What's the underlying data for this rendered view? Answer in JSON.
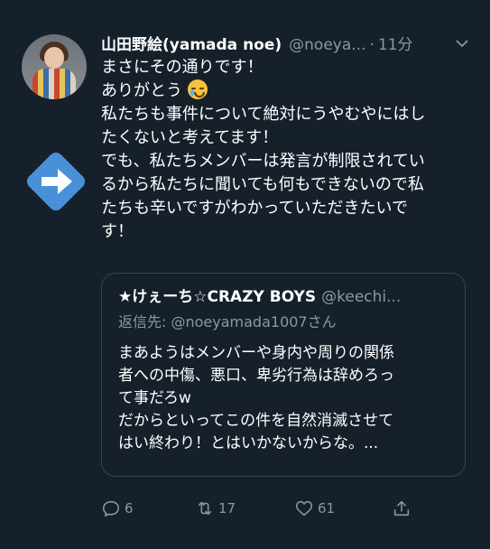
{
  "tweet": {
    "author_name": "山田野絵(yamada noe)",
    "author_handle": "@noeya...",
    "separator": "·",
    "time": "11分",
    "body_lines": [
      "まさにその通りです！",
      "ありがとう",
      "私たちも事件について絶対にうやむやにはし",
      "たくないと考えてます！",
      "でも、私たちメンバーは発言が制限されてい",
      "るから私たちに聞いても何もできないので私",
      "たちも辛いですがわかっていただきたいで",
      "す！"
    ],
    "emoji": "crying-face-emoji"
  },
  "quote": {
    "author_name": "★けぇーち☆CRAZY BOYS",
    "author_handle": "@keechi...",
    "reply_prefix": "返信先: ",
    "reply_mention": "@noeyamada1007さん",
    "body_lines": [
      "まあようはメンバーや身内や周りの関係",
      "者への中傷、悪口、卑劣行為は辞めろっ",
      "て事だろw",
      "だからといってこの件を自然消滅させて",
      "はい終わり！とはいかないからな。..."
    ]
  },
  "actions": {
    "reply_count": "6",
    "retweet_count": "17",
    "like_count": "61",
    "share_label": ""
  },
  "icons": {
    "retweet_icon": "retweet-icon",
    "reply_icon": "reply-icon",
    "like_icon": "heart-icon",
    "share_icon": "share-icon",
    "chevron": "chevron-down-icon",
    "retweeted_badge": "arrow-right-icon"
  },
  "colors": {
    "background": "#15202b",
    "muted": "#8899a6",
    "badge": "#4a90d9",
    "border": "#38444d"
  }
}
